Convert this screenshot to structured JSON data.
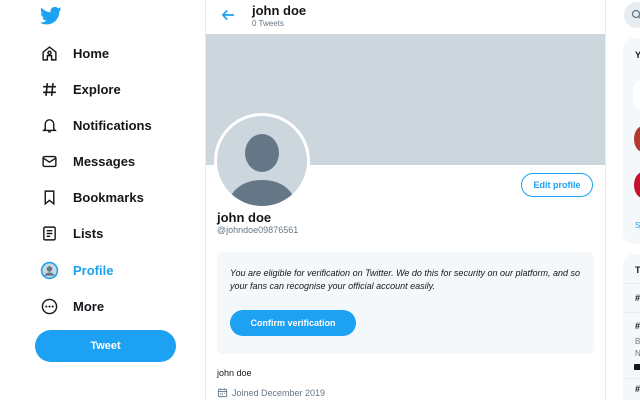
{
  "nav": {
    "items": [
      {
        "label": "Home",
        "icon": "home-icon"
      },
      {
        "label": "Explore",
        "icon": "hashtag-icon"
      },
      {
        "label": "Notifications",
        "icon": "bell-icon"
      },
      {
        "label": "Messages",
        "icon": "envelope-icon"
      },
      {
        "label": "Bookmarks",
        "icon": "bookmark-icon"
      },
      {
        "label": "Lists",
        "icon": "list-icon"
      },
      {
        "label": "Profile",
        "icon": "profile-icon"
      },
      {
        "label": "More",
        "icon": "more-icon"
      }
    ],
    "active": "Profile",
    "tweet_label": "Tweet"
  },
  "header": {
    "title": "john doe",
    "subtitle": "0 Tweets"
  },
  "profile": {
    "edit_label": "Edit profile",
    "name": "john doe",
    "handle": "@johndoe09876561",
    "bio": "john doe",
    "joined": "Joined December 2019"
  },
  "verification": {
    "text": "You are eligible for verification on Twitter. We do this for security on our platform, and so your fans can recognise your official account easily.",
    "button_label": "Confirm verification"
  },
  "sidebar": {
    "heading_fragment": "Y",
    "link_fragment": "S",
    "trends_fragment": "T",
    "trend_fragments": [
      "#",
      "#",
      "B",
      "N",
      "#"
    ]
  },
  "colors": {
    "accent": "#1da1f2",
    "banner": "#ccd6dd",
    "avatar_silhouette": "#657786"
  }
}
